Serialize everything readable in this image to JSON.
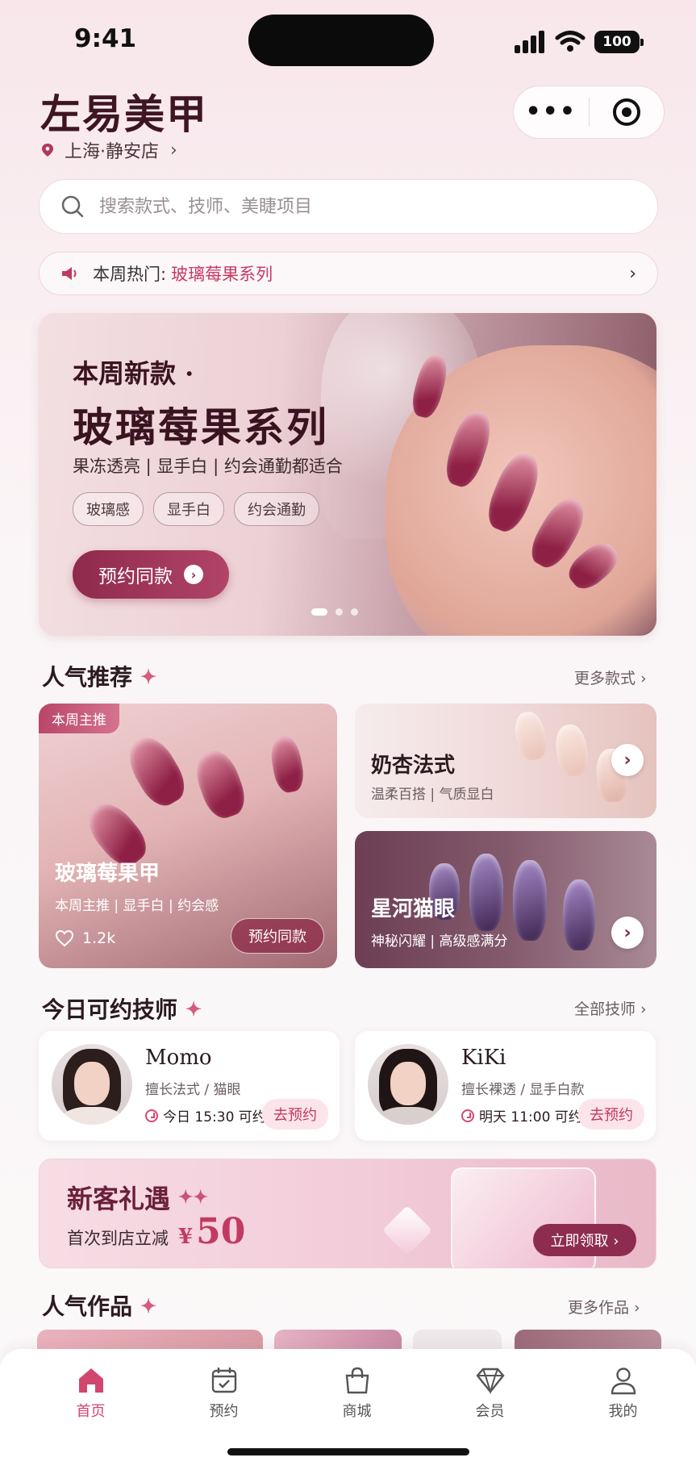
{
  "status": {
    "time": "9:41",
    "battery": "100"
  },
  "header": {
    "brand": "左易美甲",
    "location": "上海·静安店"
  },
  "search": {
    "placeholder": "搜索款式、技师、美睫项目"
  },
  "notice": {
    "label": "本周热门:",
    "highlight": "玻璃莓果系列"
  },
  "hero": {
    "kicker": "本周新款 ·",
    "title": "玻璃莓果系列",
    "subtitle": "果冻透亮 | 显手白 | 约会通勤都适合",
    "tags": [
      "玻璃感",
      "显手白",
      "约会通勤"
    ],
    "cta": "预约同款",
    "slides": 3,
    "active_slide": 1
  },
  "popular": {
    "title": "人气推荐",
    "more": "更多款式 ›",
    "featured": {
      "badge": "本周主推",
      "name": "玻璃莓果甲",
      "desc": "本周主推 | 显手白 | 约会感",
      "likes": "1.2k",
      "cta": "预约同款"
    },
    "items": [
      {
        "name": "奶杏法式",
        "desc": "温柔百搭 | 气质显白"
      },
      {
        "name": "星河猫眼",
        "desc": "神秘闪耀 | 高级感满分"
      }
    ]
  },
  "techs": {
    "title": "今日可约技师",
    "more": "全部技师 ›",
    "list": [
      {
        "name": "Momo",
        "skill": "擅长法式 / 猫眼",
        "time": "今日 15:30 可约",
        "cta": "去预约"
      },
      {
        "name": "KiKi",
        "skill": "擅长裸透 / 显手白款",
        "time": "明天 11:00 可约",
        "cta": "去预约"
      }
    ]
  },
  "promo": {
    "title": "新客礼遇",
    "text": "首次到店立减",
    "currency": "¥",
    "amount": "50",
    "cta": "立即领取 ›"
  },
  "works": {
    "title": "人气作品",
    "more": "更多作品 ›"
  },
  "tabs": [
    {
      "label": "首页",
      "icon": "home-icon",
      "active": true
    },
    {
      "label": "预约",
      "icon": "calendar-icon",
      "active": false
    },
    {
      "label": "商城",
      "icon": "bag-icon",
      "active": false
    },
    {
      "label": "会员",
      "icon": "diamond-icon",
      "active": false
    },
    {
      "label": "我的",
      "icon": "user-icon",
      "active": false
    }
  ],
  "colors": {
    "accent": "#d0466f",
    "brand_dark": "#8f2a4c"
  }
}
